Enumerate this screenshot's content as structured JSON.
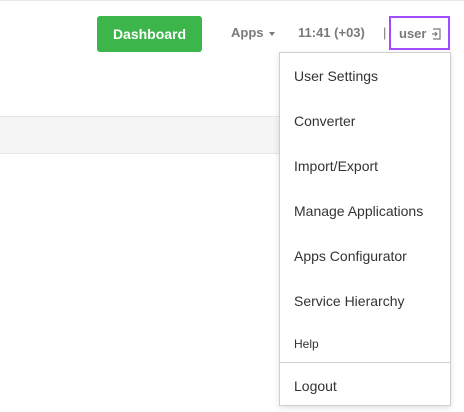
{
  "header": {
    "dashboard_label": "Dashboard",
    "apps_label": "Apps",
    "time_label": "11:41 (+03)",
    "separator": "|",
    "user_label": "user"
  },
  "colors": {
    "dashboard_button": "#3cb54a",
    "highlight_outline": "#a24cff"
  },
  "icons": {
    "apps_dropdown": "caret-down-icon",
    "user_logout": "logout-icon"
  },
  "user_menu": {
    "items": [
      {
        "label": "User Settings"
      },
      {
        "label": "Converter"
      },
      {
        "label": "Import/Export"
      },
      {
        "label": "Manage Applications"
      },
      {
        "label": "Apps Configurator"
      },
      {
        "label": "Service Hierarchy"
      },
      {
        "label": "Help"
      },
      {
        "label": "Logout"
      }
    ]
  }
}
